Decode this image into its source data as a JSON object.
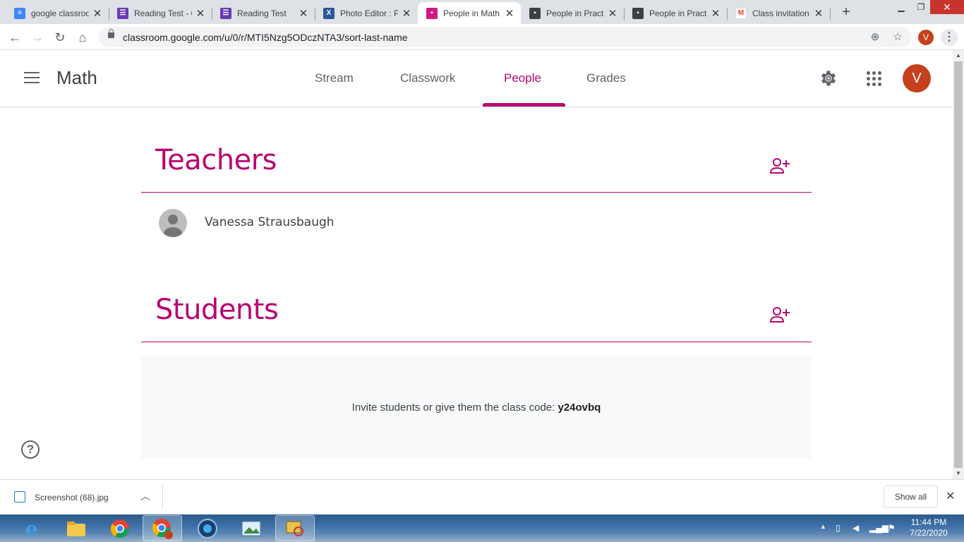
{
  "browser": {
    "tabs": [
      {
        "label": "google classroom",
        "icon": "docs-icon",
        "color": "#4285f4",
        "close": "✕"
      },
      {
        "label": "Reading Test - G",
        "icon": "forms-icon",
        "color": "#673ab7",
        "close": "✕"
      },
      {
        "label": "Reading Test",
        "icon": "forms-icon",
        "color": "#673ab7",
        "close": "✕"
      },
      {
        "label": "Photo Editor : Pi",
        "icon": "pixlr-icon",
        "color": "#2b5797",
        "close": "✕"
      },
      {
        "label": "People in Math",
        "icon": "classroom-people-icon",
        "color": "#d01884",
        "close": "✕"
      },
      {
        "label": "People in Practi",
        "icon": "classroom-people-icon",
        "color": "#3c4043",
        "close": "✕"
      },
      {
        "label": "People in Practi",
        "icon": "classroom-people-icon",
        "color": "#3c4043",
        "close": "✕"
      },
      {
        "label": "Class invitation",
        "icon": "gmail-icon",
        "color": "#ea4335",
        "close": "✕"
      }
    ],
    "new_tab": "+",
    "url": "classroom.google.com/u/0/r/MTI5Nzg5ODczNTA3/sort-last-name",
    "profile_initial": "V"
  },
  "app": {
    "class_name": "Math",
    "nav_tabs": [
      "Stream",
      "Classwork",
      "People",
      "Grades"
    ],
    "active_tab": "People",
    "avatar_initial": "V",
    "accent_color": "#b80672"
  },
  "teachers": {
    "title": "Teachers",
    "list": [
      "Vanessa Strausbaugh"
    ]
  },
  "students": {
    "title": "Students",
    "invite_text": "Invite students or give them the class code: ",
    "class_code": "y24ovbq"
  },
  "downloads": {
    "file_name": "Screenshot (68).jpg",
    "show_all": "Show all"
  },
  "taskbar": {
    "time": "11:44 PM",
    "date": "7/22/2020"
  }
}
